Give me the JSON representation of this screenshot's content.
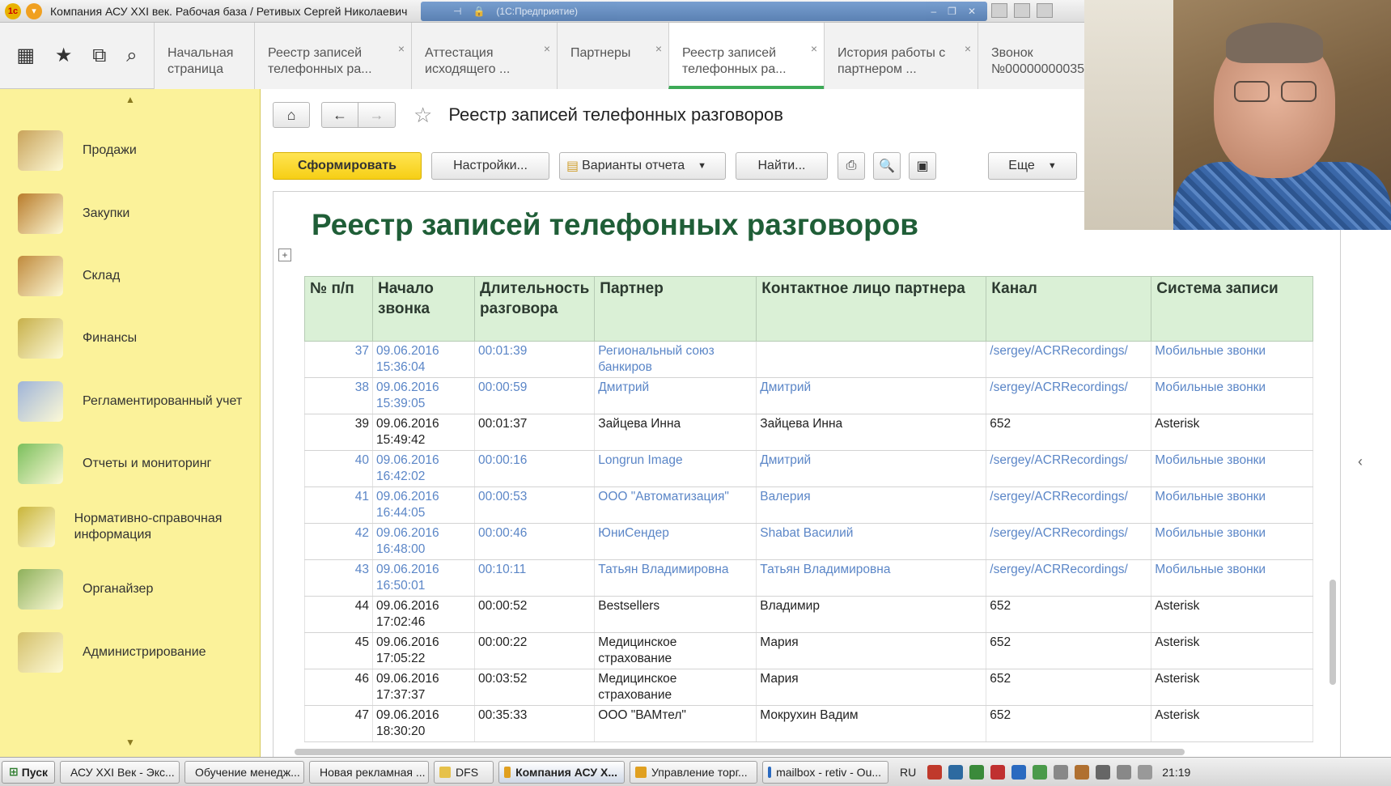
{
  "window": {
    "title": "Компания АСУ XXI век. Рабочая база / Ретивых Сергей Николаевич",
    "remote_bar_text": [
      "(1С:Предприятие)"
    ]
  },
  "quick_icons": [
    "apps-grid-icon",
    "favorites-star-icon",
    "history-icon",
    "search-icon"
  ],
  "tabs": [
    {
      "label": "Начальная страница",
      "closable": false
    },
    {
      "label": "Реестр записей телефонных ра...",
      "closable": true
    },
    {
      "label": "Аттестация исходящего ...",
      "closable": true
    },
    {
      "label": "Партнеры",
      "closable": true
    },
    {
      "label": "Реестр записей телефонных ра...",
      "closable": true,
      "active": true
    },
    {
      "label": "История работы с партнером ...",
      "closable": true
    },
    {
      "label": "Звонок №00000000035",
      "closable": false
    }
  ],
  "sidebar": {
    "items": [
      {
        "label": "Продажи",
        "icon": "truck-icon",
        "color": "#c9a35a"
      },
      {
        "label": "Закупки",
        "icon": "boxes-icon",
        "color": "#b97c2b"
      },
      {
        "label": "Склад",
        "icon": "warehouse-shelves-icon",
        "color": "#c08a3c"
      },
      {
        "label": "Финансы",
        "icon": "coins-icon",
        "color": "#c7b04a"
      },
      {
        "label": "Регламентированный учет",
        "icon": "ledger-icon",
        "color": "#9fb4d8"
      },
      {
        "label": "Отчеты и мониторинг",
        "icon": "bar-chart-icon",
        "color": "#7bbf5c"
      },
      {
        "label": "Нормативно-справочная информация",
        "icon": "binders-icon",
        "color": "#c9b53a"
      },
      {
        "label": "Органайзер",
        "icon": "clipboard-icon",
        "color": "#8db05a"
      },
      {
        "label": "Администрирование",
        "icon": "database-icon",
        "color": "#d4c06a"
      }
    ]
  },
  "content": {
    "page_title": "Реестр записей телефонных разговоров",
    "toolbar": {
      "generate_label": "Сформировать",
      "settings_label": "Настройки...",
      "variants_label": "Варианты отчета",
      "find_label": "Найти...",
      "more_label": "Еще"
    },
    "report": {
      "title": "Реестр записей телефонных разговоров",
      "columns": [
        "№ п/п",
        "Начало звонка",
        "Длительность разговора",
        "Партнер",
        "Контактное лицо партнера",
        "Канал",
        "Система записи"
      ],
      "rows": [
        {
          "n": "37",
          "start": "09.06.2016 15:36:04",
          "dur": "00:01:39",
          "partner": "Региональный союз банкиров",
          "contact": "",
          "channel": "/sergey/ACRRecordings/",
          "system": "Мобильные звонки",
          "link": true
        },
        {
          "n": "38",
          "start": "09.06.2016 15:39:05",
          "dur": "00:00:59",
          "partner": "Дмитрий",
          "contact": "Дмитрий",
          "channel": "/sergey/ACRRecordings/",
          "system": "Мобильные звонки",
          "link": true
        },
        {
          "n": "39",
          "start": "09.06.2016 15:49:42",
          "dur": "00:01:37",
          "partner": "Зайцева Инна",
          "contact": "Зайцева Инна",
          "channel": "652",
          "system": "Asterisk",
          "link": false
        },
        {
          "n": "40",
          "start": "09.06.2016 16:42:02",
          "dur": "00:00:16",
          "partner": "Longrun Image",
          "contact": "Дмитрий",
          "channel": "/sergey/ACRRecordings/",
          "system": "Мобильные звонки",
          "link": true
        },
        {
          "n": "41",
          "start": "09.06.2016 16:44:05",
          "dur": "00:00:53",
          "partner": "ООО \"Автоматизация\"",
          "contact": "Валерия",
          "channel": "/sergey/ACRRecordings/",
          "system": "Мобильные звонки",
          "link": true
        },
        {
          "n": "42",
          "start": "09.06.2016 16:48:00",
          "dur": "00:00:46",
          "partner": "ЮниСендер",
          "contact": "Shabat Василий",
          "channel": "/sergey/ACRRecordings/",
          "system": "Мобильные звонки",
          "link": true
        },
        {
          "n": "43",
          "start": "09.06.2016 16:50:01",
          "dur": "00:10:11",
          "partner": "Татьян Владимировна",
          "contact": "Татьян Владимировна",
          "channel": "/sergey/ACRRecordings/",
          "system": "Мобильные звонки",
          "link": true
        },
        {
          "n": "44",
          "start": "09.06.2016 17:02:46",
          "dur": "00:00:52",
          "partner": "Bestsellers",
          "contact": "Владимир",
          "channel": "652",
          "system": "Asterisk",
          "link": false
        },
        {
          "n": "45",
          "start": "09.06.2016 17:05:22",
          "dur": "00:00:22",
          "partner": "Медицинское страхование",
          "contact": "Мария",
          "channel": "652",
          "system": "Asterisk",
          "link": false
        },
        {
          "n": "46",
          "start": "09.06.2016 17:37:37",
          "dur": "00:03:52",
          "partner": "Медицинское страхование",
          "contact": "Мария",
          "channel": "652",
          "system": "Asterisk",
          "link": false
        },
        {
          "n": "47",
          "start": "09.06.2016 18:30:20",
          "dur": "00:35:33",
          "partner": "ООО \"ВАМтел\"",
          "contact": "Мокрухин Вадим",
          "channel": "652",
          "system": "Asterisk",
          "link": false
        }
      ]
    }
  },
  "taskbar": {
    "start_label": "Пуск",
    "tasks": [
      {
        "label": "АСУ XXI Век - Экс...",
        "color": "#c0392b"
      },
      {
        "label": "Обучение менедж...",
        "color": "#e6c14a"
      },
      {
        "label": "Новая рекламная ...",
        "color": "#e6c14a"
      },
      {
        "label": "DFS",
        "color": "#e6c14a"
      },
      {
        "label": "Компания АСУ Х...",
        "color": "#e0a020",
        "active": true
      },
      {
        "label": "Управление торг...",
        "color": "#e0a020"
      },
      {
        "label": "mailbox - retiv - Ou...",
        "color": "#2a6ac0"
      }
    ],
    "lang": "RU",
    "clock": "21:19",
    "tray_colors": [
      "#c0392b",
      "#2d6aa0",
      "#3a8a3a",
      "#c03030",
      "#2a6ac0",
      "#4a9a4a",
      "#888888",
      "#b07030",
      "#666666",
      "#888888",
      "#999999"
    ]
  },
  "colors": {
    "accent_green": "#3daa57",
    "sidebar_bg": "#fbf29a",
    "primary_button": "#f6cf15",
    "report_title": "#1f5e37",
    "link_blue": "#5b86c7"
  }
}
